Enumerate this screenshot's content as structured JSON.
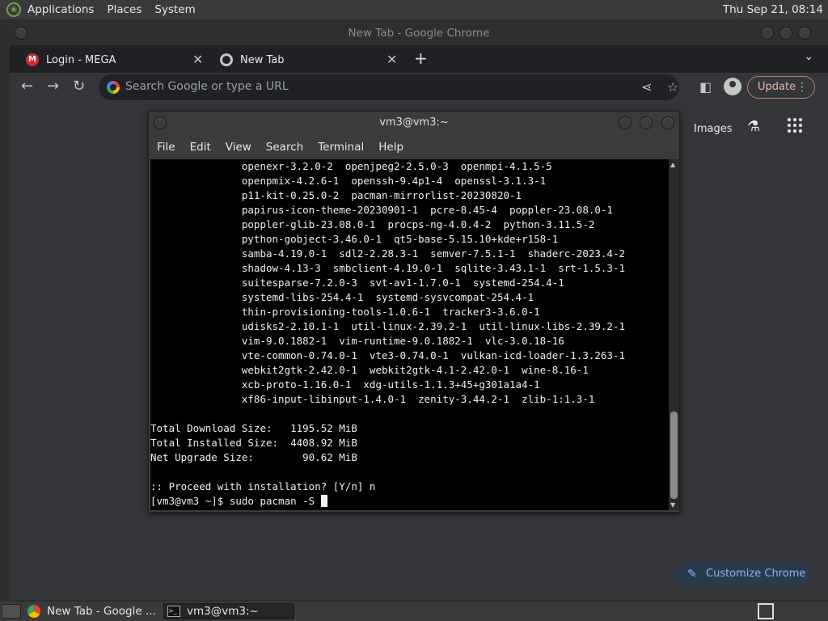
{
  "top_panel": {
    "menus": [
      "Applications",
      "Places",
      "System"
    ],
    "clock": "Thu Sep 21, 08:14"
  },
  "chrome": {
    "window_title": "New Tab - Google Chrome",
    "tabs": [
      {
        "label": "Login - MEGA",
        "icon": "mega-icon"
      },
      {
        "label": "New Tab",
        "icon": "chrome-icon"
      }
    ],
    "omnibox_placeholder": "Search Google or type a URL",
    "update_label": "Update",
    "ntp_images_label": "Images",
    "customize_label": "Customize Chrome"
  },
  "terminal": {
    "title": "vm3@vm3:~",
    "menus": [
      "File",
      "Edit",
      "View",
      "Search",
      "Terminal",
      "Help"
    ],
    "lines": [
      "               openexr-3.2.0-2  openjpeg2-2.5.0-3  openmpi-4.1.5-5",
      "               openpmix-4.2.6-1  openssh-9.4p1-4  openssl-3.1.3-1",
      "               p11-kit-0.25.0-2  pacman-mirrorlist-20230820-1",
      "               papirus-icon-theme-20230901-1  pcre-8.45-4  poppler-23.08.0-1",
      "               poppler-glib-23.08.0-1  procps-ng-4.0.4-2  python-3.11.5-2",
      "               python-gobject-3.46.0-1  qt5-base-5.15.10+kde+r158-1",
      "               samba-4.19.0-1  sdl2-2.28.3-1  semver-7.5.1-1  shaderc-2023.4-2",
      "               shadow-4.13-3  smbclient-4.19.0-1  sqlite-3.43.1-1  srt-1.5.3-1",
      "               suitesparse-7.2.0-3  svt-av1-1.7.0-1  systemd-254.4-1",
      "               systemd-libs-254.4-1  systemd-sysvcompat-254.4-1",
      "               thin-provisioning-tools-1.0.6-1  tracker3-3.6.0-1",
      "               udisks2-2.10.1-1  util-linux-2.39.2-1  util-linux-libs-2.39.2-1",
      "               vim-9.0.1882-1  vim-runtime-9.0.1882-1  vlc-3.0.18-16",
      "               vte-common-0.74.0-1  vte3-0.74.0-1  vulkan-icd-loader-1.3.263-1",
      "               webkit2gtk-2.42.0-1  webkit2gtk-4.1-2.42.0-1  wine-8.16-1",
      "               xcb-proto-1.16.0-1  xdg-utils-1.1.3+45+g301a1a4-1",
      "               xf86-input-libinput-1.4.0-1  zenity-3.44.2-1  zlib-1:1.3-1",
      "",
      "Total Download Size:   1195.52 MiB",
      "Total Installed Size:  4408.92 MiB",
      "Net Upgrade Size:        90.62 MiB",
      "",
      ":: Proceed with installation? [Y/n] n"
    ],
    "prompt": "[vm3@vm3 ~]$ sudo pacman -S "
  },
  "taskbar": {
    "items": [
      {
        "label": "New Tab - Google ...",
        "icon": "chrome-icon"
      },
      {
        "label": "vm3@vm3:~",
        "icon": "terminal-icon"
      }
    ]
  }
}
